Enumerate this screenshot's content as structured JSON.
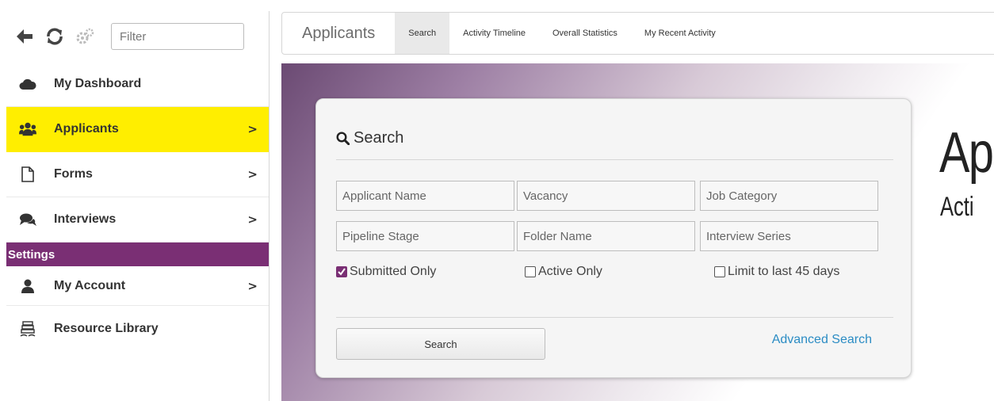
{
  "toolbar": {
    "filter_placeholder": "Filter",
    "icons": [
      "back-arrow-icon",
      "refresh-icon",
      "gears-icon"
    ]
  },
  "sidebar": {
    "items": [
      {
        "label": "My Dashboard",
        "icon": "cloud-icon",
        "has_chevron": false
      },
      {
        "label": "Applicants",
        "icon": "users-icon",
        "has_chevron": true,
        "highlighted": true
      },
      {
        "label": "Forms",
        "icon": "file-icon",
        "has_chevron": true
      },
      {
        "label": "Interviews",
        "icon": "comments-icon",
        "has_chevron": true
      }
    ],
    "section_label": "Settings",
    "settings_items": [
      {
        "label": "My Account",
        "icon": "user-icon",
        "has_chevron": true
      },
      {
        "label": "Resource Library",
        "icon": "library-icon",
        "has_chevron": false
      }
    ],
    "chevron": ">"
  },
  "topnav": {
    "title": "Applicants",
    "tabs": [
      {
        "label": "Search",
        "active": true
      },
      {
        "label": "Activity Timeline",
        "active": false
      },
      {
        "label": "Overall Statistics",
        "active": false
      },
      {
        "label": "My Recent Activity",
        "active": false
      }
    ]
  },
  "hero": {
    "big_text": "Ap",
    "sub_text": "Acti"
  },
  "search": {
    "title": "Search",
    "fields": {
      "applicant_name": "Applicant Name",
      "vacancy": "Vacancy",
      "job_category": "Job Category",
      "pipeline_stage": "Pipeline Stage",
      "folder_name": "Folder Name",
      "interview_series": "Interview Series"
    },
    "checkboxes": [
      {
        "label": "Submitted Only",
        "checked": true
      },
      {
        "label": "Active Only",
        "checked": false
      },
      {
        "label": "Limit to last 45 days",
        "checked": false
      }
    ],
    "button_label": "Search",
    "advanced_link": "Advanced Search"
  },
  "colors": {
    "accent_purple": "#7a2f74",
    "highlight_yellow": "#ffee00",
    "link_blue": "#2b8cc4"
  }
}
